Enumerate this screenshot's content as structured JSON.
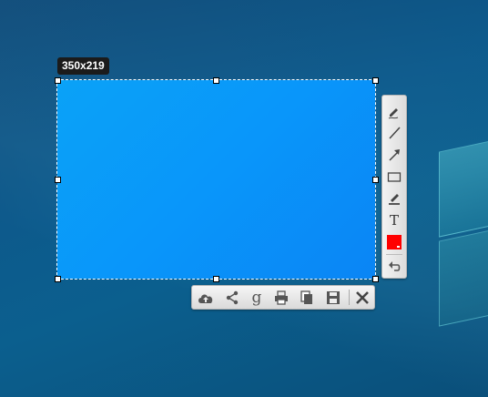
{
  "selection": {
    "size_label": "350x219"
  },
  "annotation_toolbar": {
    "tools": [
      {
        "icon": "pencil-icon"
      },
      {
        "icon": "line-icon"
      },
      {
        "icon": "arrow-icon"
      },
      {
        "icon": "rectangle-icon"
      },
      {
        "icon": "marker-icon"
      },
      {
        "icon": "text-icon",
        "label": "T"
      },
      {
        "icon": "color-picker-icon",
        "color": "#ff0000"
      },
      {
        "icon": "undo-icon"
      }
    ]
  },
  "action_toolbar": {
    "tools": [
      {
        "icon": "cloud-upload-icon"
      },
      {
        "icon": "share-icon"
      },
      {
        "icon": "google-search-icon",
        "label": "g"
      },
      {
        "icon": "print-icon"
      },
      {
        "icon": "copy-icon"
      },
      {
        "icon": "save-icon"
      },
      {
        "icon": "close-icon"
      }
    ]
  },
  "colors": {
    "selection_fill": "#0a96f7",
    "desktop": "#0d5a8c",
    "current_color": "#ff0000"
  }
}
